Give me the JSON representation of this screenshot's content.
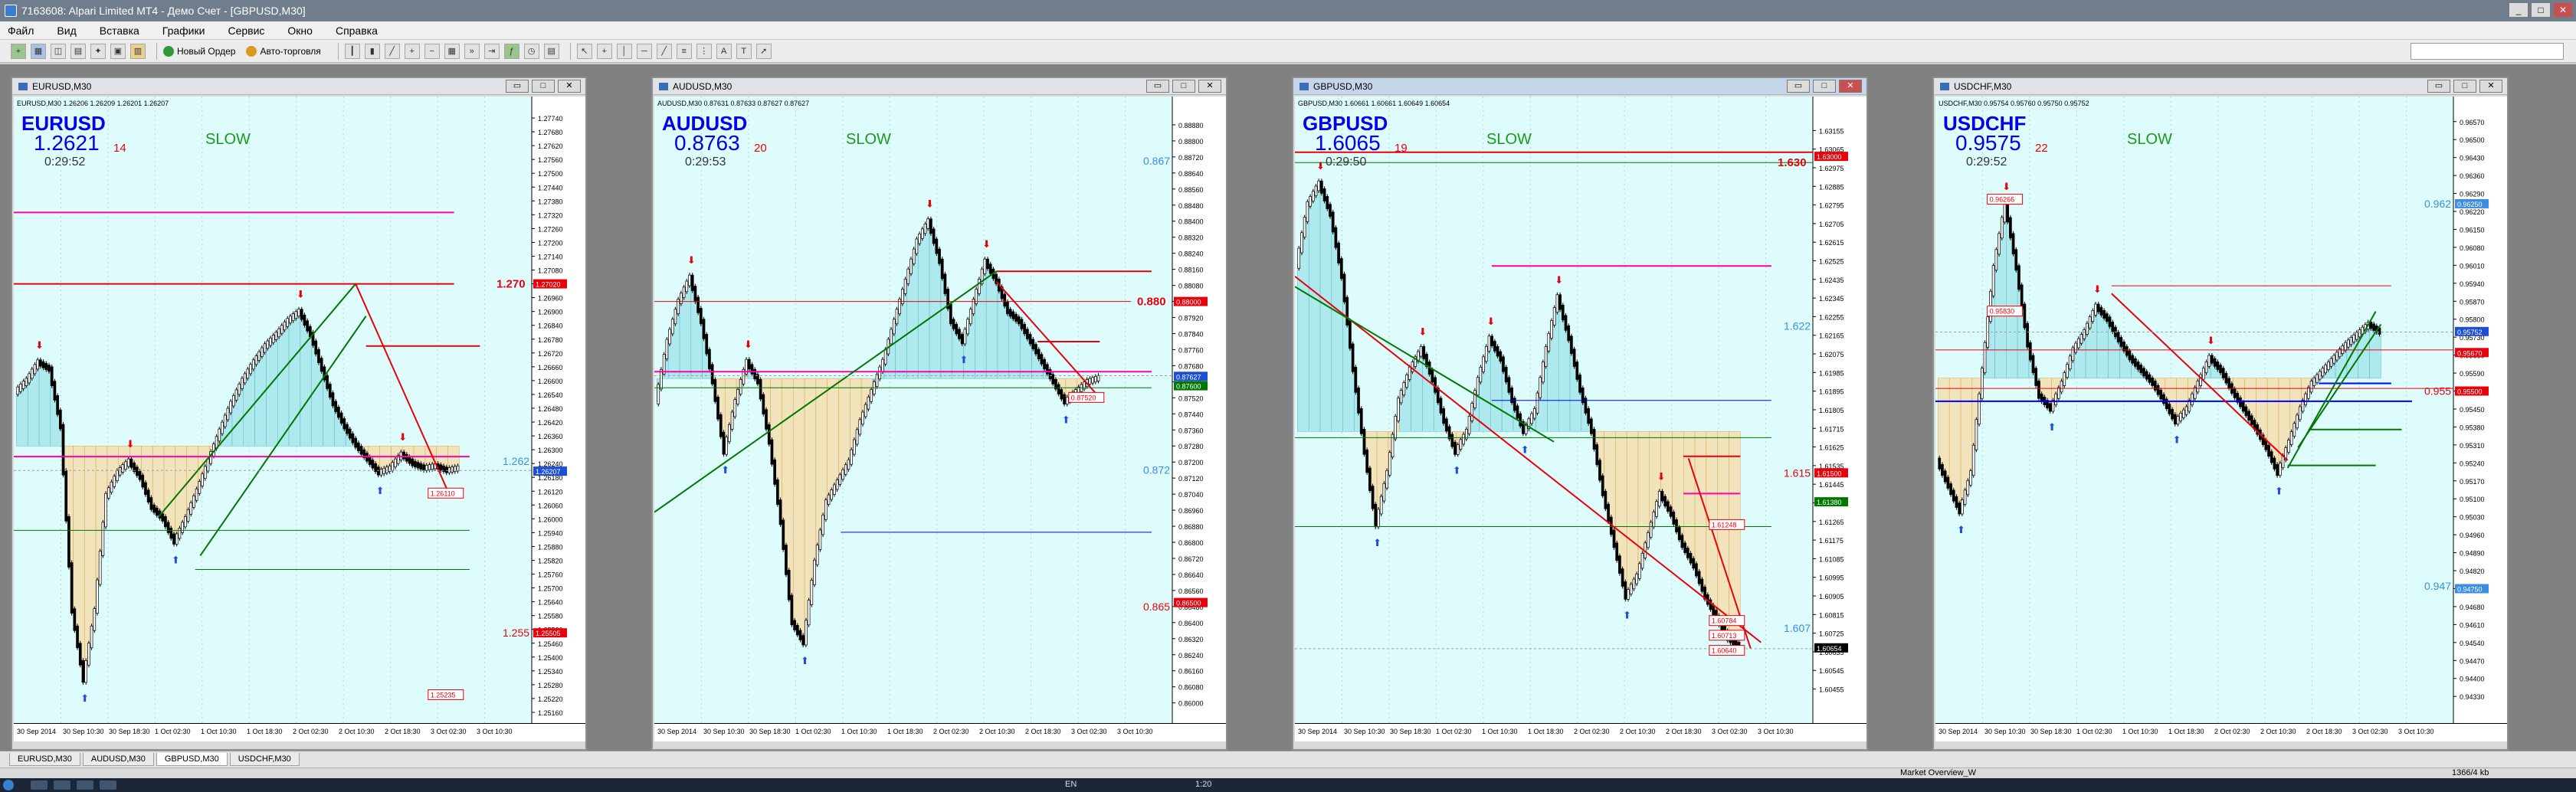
{
  "window": {
    "title": "7163608: Alpari Limited MT4 - Демо Счет - [GBPUSD,M30]",
    "min": "_",
    "max": "□",
    "close": "✕"
  },
  "menu": [
    "Файл",
    "Вид",
    "Вставка",
    "Графики",
    "Сервис",
    "Окно",
    "Справка"
  ],
  "toolbar": {
    "new_order": "Новый Ордер",
    "autotrade": "Авто-торговля"
  },
  "colors": {
    "bg": "#dffcfc",
    "fillBull": "#a6e6ea",
    "fillBear": "#f5deb0",
    "red": "#e8000b",
    "magenta": "#ff00aa",
    "green": "#007700",
    "blue": "#0000ff"
  },
  "charts": [
    {
      "id": "EURUSD",
      "title": "EURUSD,M30",
      "info": "EURUSD,M30 1.26206 1.26209 1.26201 1.26207",
      "symbol": "EURUSD",
      "price": "1.2621",
      "spread": "14",
      "timer": "0:29:52",
      "mode": "SLOW",
      "ymin": 1.2514,
      "ymax": 1.2778,
      "prices": [
        "1.27740",
        "1.27680",
        "1.27620",
        "1.27560",
        "1.27500",
        "1.27440",
        "1.27380",
        "1.27320",
        "1.27260",
        "1.27200",
        "1.27140",
        "1.27080",
        "1.27020",
        "1.26960",
        "1.26900",
        "1.26840",
        "1.26780",
        "1.26720",
        "1.26660",
        "1.26600",
        "1.26540",
        "1.26480",
        "1.26420",
        "1.26360",
        "1.26300",
        "1.26240",
        "1.26180",
        "1.26120",
        "1.26060",
        "1.26000",
        "1.25940",
        "1.25880",
        "1.25820",
        "1.25760",
        "1.25700",
        "1.25640",
        "1.25580",
        "1.25520",
        "1.25460",
        "1.25400",
        "1.25340",
        "1.25280",
        "1.25220",
        "1.25160"
      ],
      "dates": [
        "30 Sep 2014",
        "30 Sep 10:30",
        "30 Sep 18:30",
        "1 Oct 02:30",
        "1 Oct 10:30",
        "1 Oct 18:30",
        "2 Oct 02:30",
        "2 Oct 10:30",
        "2 Oct 18:30",
        "3 Oct 02:30",
        "3 Oct 10:30"
      ],
      "labelsLeft": [
        {
          "text": "1.25235",
          "v": 1.25235
        },
        {
          "text": "1.26110",
          "v": 1.2611
        }
      ],
      "bigLabels": [
        {
          "text": "1.270",
          "v": 1.2702,
          "color": "#e8000b",
          "big": true
        },
        {
          "text": "1.262",
          "v": 1.2625,
          "color": "#3c8ee0"
        },
        {
          "text": "1.255",
          "v": 1.25505,
          "color": "#e8000b"
        }
      ],
      "boxes": [
        {
          "text": "1.27020",
          "v": 1.2702,
          "bg": "#e8000b",
          "fg": "#ffffff"
        },
        {
          "text": "1.26207",
          "v": 1.26207,
          "bg": "#1d4ed8",
          "fg": "#ffffff"
        },
        {
          "text": "1.25505",
          "v": 1.25505,
          "bg": "#e8000b",
          "fg": "#ffffff"
        }
      ],
      "profile": [
        1.2655,
        1.266,
        1.2668,
        1.2665,
        1.264,
        1.256,
        1.253,
        1.256,
        1.261,
        1.262,
        1.2625,
        1.2618,
        1.2605,
        1.26,
        1.259,
        1.26,
        1.2612,
        1.2625,
        1.2638,
        1.265,
        1.266,
        1.2668,
        1.2675,
        1.268,
        1.2686,
        1.269,
        1.268,
        1.2665,
        1.265,
        1.264,
        1.2632,
        1.2626,
        1.262,
        1.2622,
        1.2628,
        1.2624,
        1.2622,
        1.2623,
        1.2621,
        1.2622
      ],
      "hlines": [
        {
          "v": 1.2733,
          "color": "#ff00aa",
          "x1": 0.0,
          "x2": 0.85,
          "w": 2
        },
        {
          "v": 1.2702,
          "color": "#e8000b",
          "x1": 0.0,
          "x2": 0.85,
          "w": 2
        },
        {
          "v": 1.2675,
          "color": "#e8000b",
          "x1": 0.68,
          "x2": 0.9,
          "w": 2
        },
        {
          "v": 1.2627,
          "color": "#ff00aa",
          "x1": 0.0,
          "x2": 0.88,
          "w": 2
        },
        {
          "v": 1.2595,
          "color": "#007700",
          "x1": 0.0,
          "x2": 0.88,
          "w": 1
        },
        {
          "v": 1.2578,
          "color": "#007700",
          "x1": 0.35,
          "x2": 0.88,
          "w": 1
        }
      ],
      "trends": [
        {
          "x1": 0.28,
          "v1": 1.2601,
          "x2": 0.66,
          "v2": 1.2702,
          "color": "#007700"
        },
        {
          "x1": 0.36,
          "v1": 1.2584,
          "x2": 0.68,
          "v2": 1.2688,
          "color": "#007700"
        },
        {
          "x1": 0.66,
          "v1": 1.2702,
          "x2": 0.84,
          "v2": 1.2611,
          "color": "#e8000b"
        }
      ]
    },
    {
      "id": "AUDUSD",
      "title": "AUDUSD,M30",
      "info": "AUDUSD,M30 0.87631 0.87633 0.87627 0.87627",
      "symbol": "AUDUSD",
      "price": "0.8763",
      "spread": "20",
      "timer": "0:29:53",
      "mode": "SLOW",
      "ymin": 0.8593,
      "ymax": 0.8896,
      "prices": [
        "0.88880",
        "0.88800",
        "0.88720",
        "0.88640",
        "0.88560",
        "0.88480",
        "0.88400",
        "0.88320",
        "0.88240",
        "0.88160",
        "0.88080",
        "0.88000",
        "0.87920",
        "0.87840",
        "0.87760",
        "0.87680",
        "0.87600",
        "0.87520",
        "0.87440",
        "0.87360",
        "0.87280",
        "0.87200",
        "0.87120",
        "0.87040",
        "0.86960",
        "0.86880",
        "0.86800",
        "0.86720",
        "0.86640",
        "0.86560",
        "0.86480",
        "0.86400",
        "0.86320",
        "0.86240",
        "0.86160",
        "0.86080",
        "0.86000"
      ],
      "dates": [
        "30 Sep 2014",
        "30 Sep 10:30",
        "30 Sep 18:30",
        "1 Oct 02:30",
        "1 Oct 10:30",
        "1 Oct 18:30",
        "2 Oct 02:30",
        "2 Oct 10:30",
        "2 Oct 18:30",
        "3 Oct 02:30",
        "3 Oct 10:30"
      ],
      "labelsLeft": [
        {
          "text": "0.87520",
          "v": 0.8752
        }
      ],
      "bigLabels": [
        {
          "text": "0.867",
          "v": 0.887,
          "color": "#3c8ee0"
        },
        {
          "text": "0.880",
          "v": 0.88,
          "color": "#e8000b",
          "big": true
        },
        {
          "text": "0.872",
          "v": 0.8716,
          "color": "#3c8ee0"
        },
        {
          "text": "0.865",
          "v": 0.8648,
          "color": "#e8000b"
        }
      ],
      "boxes": [
        {
          "text": "0.88000",
          "v": 0.88,
          "bg": "#e8000b",
          "fg": "#ffffff"
        },
        {
          "text": "0.87627",
          "v": 0.87627,
          "bg": "#1d4ed8",
          "fg": "#ffffff"
        },
        {
          "text": "0.87600",
          "v": 0.8758,
          "bg": "#007700",
          "fg": "#ffffff"
        },
        {
          "text": "0.86500",
          "v": 0.865,
          "bg": "#e8000b",
          "fg": "#ffffff"
        }
      ],
      "profile": [
        0.875,
        0.878,
        0.88,
        0.8812,
        0.879,
        0.876,
        0.8725,
        0.875,
        0.877,
        0.876,
        0.873,
        0.869,
        0.864,
        0.863,
        0.867,
        0.87,
        0.871,
        0.872,
        0.874,
        0.8755,
        0.877,
        0.879,
        0.881,
        0.883,
        0.884,
        0.882,
        0.879,
        0.878,
        0.88,
        0.882,
        0.881,
        0.8795,
        0.879,
        0.878,
        0.877,
        0.876,
        0.875,
        0.8755,
        0.876,
        0.8762
      ],
      "hlines": [
        {
          "v": 0.8815,
          "color": "#e8000b",
          "x1": 0.66,
          "x2": 0.96,
          "w": 2
        },
        {
          "v": 0.88,
          "color": "#e8000b",
          "x1": 0.0,
          "x2": 0.92,
          "w": 1
        },
        {
          "v": 0.878,
          "color": "#e8000b",
          "x1": 0.74,
          "x2": 0.86,
          "w": 2
        },
        {
          "v": 0.8765,
          "color": "#ff00aa",
          "x1": 0.0,
          "x2": 0.96,
          "w": 2
        },
        {
          "v": 0.8757,
          "color": "#007700",
          "x1": 0.0,
          "x2": 0.96,
          "w": 1
        },
        {
          "v": 0.8685,
          "color": "#0000ff",
          "x1": 0.36,
          "x2": 0.96,
          "w": 1
        }
      ],
      "trends": [
        {
          "x1": 0.0,
          "v1": 0.8695,
          "x2": 0.66,
          "v2": 0.8815,
          "color": "#007700"
        },
        {
          "x1": 0.66,
          "v1": 0.881,
          "x2": 0.86,
          "v2": 0.8752,
          "color": "#e8000b"
        }
      ]
    },
    {
      "id": "GBPUSD",
      "title": "GBPUSD,M30",
      "info": "GBPUSD,M30 1.60661 1.60661 1.60649 1.60654",
      "symbol": "GBPUSD",
      "price": "1.6065",
      "spread": "19",
      "timer": "0:29:50",
      "mode": "SLOW",
      "ymin": 1.6032,
      "ymax": 1.6326,
      "prices": [
        "1.63155",
        "1.63065",
        "1.62975",
        "1.62885",
        "1.62795",
        "1.62705",
        "1.62615",
        "1.62525",
        "1.62435",
        "1.62345",
        "1.62255",
        "1.62165",
        "1.62075",
        "1.61985",
        "1.61895",
        "1.61805",
        "1.61715",
        "1.61625",
        "1.61535",
        "1.61445",
        "1.61355",
        "1.61265",
        "1.61175",
        "1.61085",
        "1.60995",
        "1.60905",
        "1.60815",
        "1.60725",
        "1.60635",
        "1.60545",
        "1.60455"
      ],
      "dates": [
        "30 Sep 2014",
        "30 Sep 10:30",
        "30 Sep 18:30",
        "1 Oct 02:30",
        "1 Oct 10:30",
        "1 Oct 18:30",
        "2 Oct 02:30",
        "2 Oct 10:30",
        "2 Oct 18:30",
        "3 Oct 02:30",
        "3 Oct 10:30"
      ],
      "labelsLeft": [
        {
          "text": "1.61248",
          "v": 1.61248
        },
        {
          "text": "1.60713",
          "v": 1.60713
        },
        {
          "text": "1.60640",
          "v": 1.6064
        },
        {
          "text": "1.60784",
          "v": 1.60784
        }
      ],
      "bigLabels": [
        {
          "text": "1.630",
          "v": 1.63,
          "color": "#e8000b",
          "big": true
        },
        {
          "text": "1.622",
          "v": 1.6221,
          "color": "#3c8ee0"
        },
        {
          "text": "1.615",
          "v": 1.615,
          "color": "#e8000b"
        },
        {
          "text": "1.607",
          "v": 1.6075,
          "color": "#3c8ee0"
        }
      ],
      "boxes": [
        {
          "text": "1.63000",
          "v": 1.6303,
          "bg": "#e8000b",
          "fg": "#ffffff"
        },
        {
          "text": "1.61500",
          "v": 1.615,
          "bg": "#e8000b",
          "fg": "#ffffff"
        },
        {
          "text": "1.61380",
          "v": 1.6136,
          "bg": "#007700",
          "fg": "#ffffff"
        },
        {
          "text": "1.60654",
          "v": 1.60654,
          "bg": "#000000",
          "fg": "#ffffff"
        }
      ],
      "profile": [
        1.625,
        1.628,
        1.629,
        1.6275,
        1.6245,
        1.62,
        1.616,
        1.6125,
        1.615,
        1.6185,
        1.62,
        1.621,
        1.6195,
        1.6175,
        1.616,
        1.617,
        1.6195,
        1.6215,
        1.6205,
        1.6185,
        1.617,
        1.618,
        1.621,
        1.6235,
        1.6215,
        1.619,
        1.617,
        1.614,
        1.6115,
        1.609,
        1.61,
        1.612,
        1.614,
        1.613,
        1.6115,
        1.6105,
        1.609,
        1.608,
        1.607,
        1.6066
      ],
      "hlines": [
        {
          "v": 1.6305,
          "color": "#e8000b",
          "x1": 0.0,
          "x2": 1.0,
          "w": 2
        },
        {
          "v": 1.63,
          "color": "#007700",
          "x1": 0.0,
          "x2": 1.0,
          "w": 1
        },
        {
          "v": 1.625,
          "color": "#ff00aa",
          "x1": 0.38,
          "x2": 0.92,
          "w": 2
        },
        {
          "v": 1.6185,
          "color": "#0000ff",
          "x1": 0.38,
          "x2": 0.92,
          "w": 1
        },
        {
          "v": 1.6167,
          "color": "#007700",
          "x1": 0.0,
          "x2": 0.92,
          "w": 1
        },
        {
          "v": 1.6158,
          "color": "#e8000b",
          "x1": 0.75,
          "x2": 0.86,
          "w": 2
        },
        {
          "v": 1.614,
          "color": "#ff00aa",
          "x1": 0.75,
          "x2": 0.86,
          "w": 2
        },
        {
          "v": 1.6124,
          "color": "#007700",
          "x1": 0.0,
          "x2": 0.92,
          "w": 1
        }
      ],
      "trends": [
        {
          "x1": 0.0,
          "v1": 1.6245,
          "x2": 0.9,
          "v2": 1.6068,
          "color": "#e8000b"
        },
        {
          "x1": 0.0,
          "v1": 1.624,
          "x2": 0.5,
          "v2": 1.6165,
          "color": "#007700"
        },
        {
          "x1": 0.76,
          "v1": 1.6157,
          "x2": 0.88,
          "v2": 1.6065,
          "color": "#e8000b"
        }
      ]
    },
    {
      "id": "USDCHF",
      "title": "USDCHF,M30",
      "info": "USDCHF,M30 0.95754 0.95760 0.95750 0.95752",
      "symbol": "USDCHF",
      "price": "0.9575",
      "spread": "22",
      "timer": "0:29:52",
      "mode": "SLOW",
      "ymin": 0.9425,
      "ymax": 0.9662,
      "prices": [
        "0.96570",
        "0.96500",
        "0.96430",
        "0.96360",
        "0.96290",
        "0.96220",
        "0.96150",
        "0.96080",
        "0.96010",
        "0.95940",
        "0.95870",
        "0.95800",
        "0.95730",
        "0.95660",
        "0.95590",
        "0.95520",
        "0.95450",
        "0.95380",
        "0.95310",
        "0.95240",
        "0.95170",
        "0.95100",
        "0.95030",
        "0.94960",
        "0.94890",
        "0.94820",
        "0.94750",
        "0.94680",
        "0.94610",
        "0.94540",
        "0.94470",
        "0.94400",
        "0.94330"
      ],
      "dates": [
        "30 Sep 2014",
        "30 Sep 10:30",
        "30 Sep 18:30",
        "1 Oct 02:30",
        "1 Oct 10:30",
        "1 Oct 18:30",
        "2 Oct 02:30",
        "2 Oct 10:30",
        "2 Oct 18:30",
        "3 Oct 02:30",
        "3 Oct 10:30"
      ],
      "labelsLeft": [
        {
          "text": "0.96266",
          "v": 0.96266
        },
        {
          "text": "0.95830",
          "v": 0.9583
        }
      ],
      "bigLabels": [
        {
          "text": "0.962",
          "v": 0.9625,
          "color": "#3c8ee0"
        },
        {
          "text": "0.955",
          "v": 0.9552,
          "color": "#e8000b"
        },
        {
          "text": "0.947",
          "v": 0.9476,
          "color": "#3c8ee0"
        }
      ],
      "boxes": [
        {
          "text": "0.96250",
          "v": 0.9625,
          "bg": "#3c8ee0",
          "fg": "#ffffff"
        },
        {
          "text": "0.95752",
          "v": 0.95752,
          "bg": "#1d4ed8",
          "fg": "#ffffff"
        },
        {
          "text": "0.95670",
          "v": 0.9567,
          "bg": "#e8000b",
          "fg": "#ffffff"
        },
        {
          "text": "0.95500",
          "v": 0.9552,
          "bg": "#e8000b",
          "fg": "#ffffff"
        },
        {
          "text": "0.94750",
          "v": 0.9475,
          "bg": "#3c8ee0",
          "fg": "#ffffff"
        }
      ],
      "profile": [
        0.9525,
        0.9515,
        0.9505,
        0.952,
        0.956,
        0.96,
        0.9625,
        0.96,
        0.957,
        0.955,
        0.9545,
        0.9555,
        0.9568,
        0.9575,
        0.9585,
        0.958,
        0.9572,
        0.9565,
        0.956,
        0.9555,
        0.9548,
        0.954,
        0.9545,
        0.9555,
        0.9565,
        0.956,
        0.9552,
        0.9545,
        0.9538,
        0.953,
        0.952,
        0.9532,
        0.9545,
        0.9555,
        0.956,
        0.9565,
        0.957,
        0.9574,
        0.9578,
        0.9575
      ],
      "hlines": [
        {
          "v": 0.9593,
          "color": "#e8000b",
          "x1": 0.34,
          "x2": 0.88,
          "w": 1
        },
        {
          "v": 0.9568,
          "color": "#e8000b",
          "x1": 0.0,
          "x2": 1.0,
          "w": 1
        },
        {
          "v": 0.9553,
          "color": "#e8000b",
          "x1": 0.0,
          "x2": 1.0,
          "w": 1
        },
        {
          "v": 0.9555,
          "color": "#0000ff",
          "x1": 0.74,
          "x2": 0.88,
          "w": 2
        },
        {
          "v": 0.9548,
          "color": "#0000ff",
          "x1": 0.0,
          "x2": 0.92,
          "w": 2
        },
        {
          "v": 0.9537,
          "color": "#007700",
          "x1": 0.72,
          "x2": 0.9,
          "w": 2
        },
        {
          "v": 0.9523,
          "color": "#007700",
          "x1": 0.68,
          "x2": 0.85,
          "w": 2
        }
      ],
      "trends": [
        {
          "x1": 0.34,
          "v1": 0.959,
          "x2": 0.68,
          "v2": 0.9525,
          "color": "#e8000b"
        },
        {
          "x1": 0.68,
          "v1": 0.9522,
          "x2": 0.85,
          "v2": 0.9583,
          "color": "#007700"
        },
        {
          "x1": 0.7,
          "v1": 0.953,
          "x2": 0.86,
          "v2": 0.9578,
          "color": "#007700"
        }
      ]
    }
  ],
  "tabs": [
    {
      "label": "EURUSD,M30"
    },
    {
      "label": "AUDUSD,M30"
    },
    {
      "label": "GBPUSD,M30"
    },
    {
      "label": "USDCHF,M30"
    }
  ],
  "status": {
    "profile": "Market Overview_W",
    "traffic": "1366/4 kb"
  },
  "taskbar": {
    "lang": "EN",
    "clock": "1:20"
  }
}
